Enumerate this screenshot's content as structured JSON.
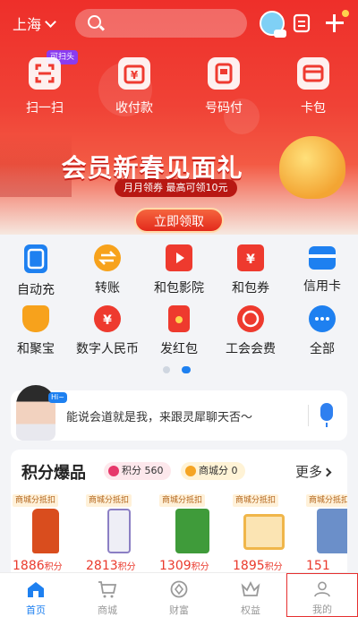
{
  "topbar": {
    "city": "上海",
    "search_placeholder": ""
  },
  "quick_actions": [
    {
      "label": "扫一扫",
      "tag": "可扫头"
    },
    {
      "label": "收付款"
    },
    {
      "label": "号码付"
    },
    {
      "label": "卡包"
    }
  ],
  "banner": {
    "title": "会员新春见面礼",
    "subtitle": "月月领券 最高可领10元",
    "cta": "立即领取"
  },
  "services": [
    [
      {
        "label": "自动充",
        "icon": "phone-recharge-icon"
      },
      {
        "label": "转账",
        "icon": "transfer-icon"
      },
      {
        "label": "和包影院",
        "icon": "cinema-icon"
      },
      {
        "label": "和包券",
        "icon": "coupon-icon"
      },
      {
        "label": "信用卡",
        "icon": "credit-card-icon"
      }
    ],
    [
      {
        "label": "和聚宝",
        "icon": "basket-icon"
      },
      {
        "label": "数字人民币",
        "icon": "digital-rmb-icon"
      },
      {
        "label": "发红包",
        "icon": "red-envelope-icon"
      },
      {
        "label": "工会会费",
        "icon": "union-icon"
      },
      {
        "label": "全部",
        "icon": "more-dots-icon"
      }
    ]
  ],
  "assistant": {
    "hi": "Hi~",
    "text": "能说会道就是我，来跟灵犀聊天否～"
  },
  "points": {
    "title": "积分爆品",
    "points_label": "积分 560",
    "mall_label": "商城分 0",
    "more": "更多",
    "products": [
      {
        "tag": "商城分抵扣",
        "price": "1886",
        "unit": "积分",
        "color": "#d94d1e"
      },
      {
        "tag": "商城分抵扣",
        "price": "2813",
        "unit": "积分",
        "color": "#8b7fc4"
      },
      {
        "tag": "商城分抵扣",
        "price": "1309",
        "unit": "积分",
        "color": "#3f9b3a"
      },
      {
        "tag": "商城分抵扣",
        "price": "1895",
        "unit": "积分",
        "color": "#f0b64a"
      },
      {
        "tag": "商城分抵扣",
        "price": "151",
        "unit": "",
        "color": "#6b8fc9"
      }
    ]
  },
  "nav": [
    {
      "label": "首页",
      "active": true
    },
    {
      "label": "商城"
    },
    {
      "label": "财富"
    },
    {
      "label": "权益"
    },
    {
      "label": "我的"
    }
  ],
  "colors": {
    "brand_red": "#ee2f2a",
    "brand_blue": "#1e80f0",
    "price_red": "#ea3a2d"
  }
}
